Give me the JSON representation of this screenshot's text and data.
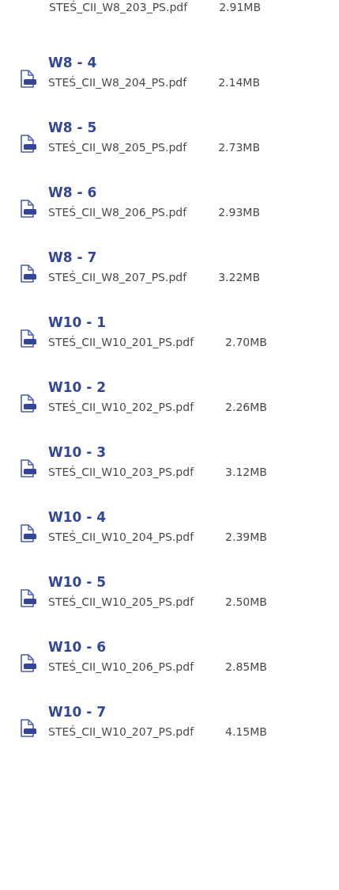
{
  "partial_file": {
    "file_name": "STEŚ_CII_W8_203_PS.pdf",
    "size": "2.91MB"
  },
  "files": [
    {
      "title": "W8 - 4",
      "file_name": "STEŚ_CII_W8_204_PS.pdf",
      "size": "2.14MB"
    },
    {
      "title": "W8 - 5",
      "file_name": "STEŚ_CII_W8_205_PS.pdf",
      "size": "2.73MB"
    },
    {
      "title": "W8 - 6",
      "file_name": "STEŚ_CII_W8_206_PS.pdf",
      "size": "2.93MB"
    },
    {
      "title": "W8 - 7",
      "file_name": "STEŚ_CII_W8_207_PS.pdf",
      "size": "3.22MB"
    },
    {
      "title": "W10 - 1",
      "file_name": "STEŚ_CII_W10_201_PS.pdf",
      "size": "2.70MB"
    },
    {
      "title": "W10 - 2",
      "file_name": "STEŚ_CII_W10_202_PS.pdf",
      "size": "2.26MB"
    },
    {
      "title": "W10 - 3",
      "file_name": "STEŚ_CII_W10_203_PS.pdf",
      "size": "3.12MB"
    },
    {
      "title": "W10 - 4",
      "file_name": "STEŚ_CII_W10_204_PS.pdf",
      "size": "2.39MB"
    },
    {
      "title": "W10 - 5",
      "file_name": "STEŚ_CII_W10_205_PS.pdf",
      "size": "2.50MB"
    },
    {
      "title": "W10 - 6",
      "file_name": "STEŚ_CII_W10_206_PS.pdf",
      "size": "2.85MB"
    },
    {
      "title": "W10 - 7",
      "file_name": "STEŚ_CII_W10_207_PS.pdf",
      "size": "4.15MB"
    }
  ]
}
